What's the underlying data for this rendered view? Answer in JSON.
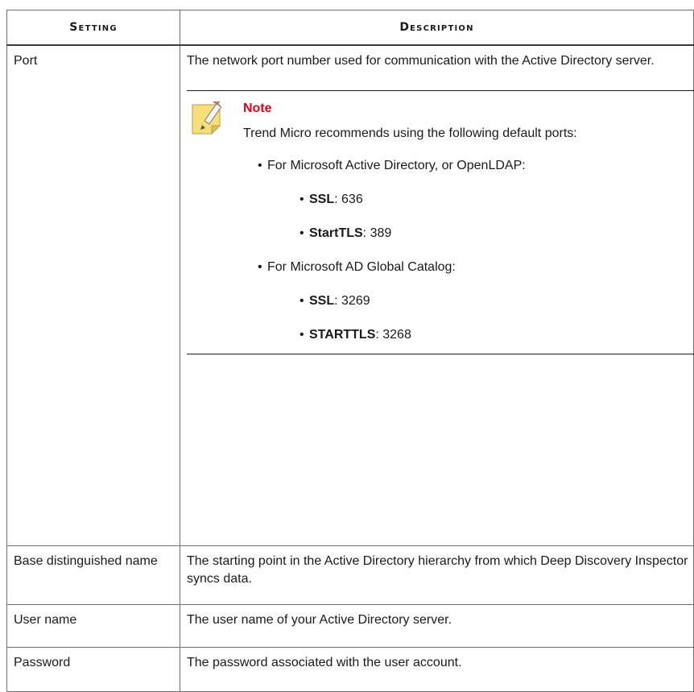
{
  "table": {
    "headers": [
      "Setting",
      "Description"
    ],
    "rows": [
      {
        "setting": "Port",
        "description": "The network port number used for communication with the Active Directory server."
      },
      {
        "setting": "Base distinguished name",
        "description": "The starting point in the Active Directory hierarchy from which Deep Discovery Inspector syncs data."
      },
      {
        "setting": "User name",
        "description": "The user name of your Active Directory server."
      },
      {
        "setting": "Password",
        "description": "The password associated with the user account."
      }
    ]
  },
  "note": {
    "title": "Note",
    "text": "Trend Micro recommends using the following default ports:",
    "groups": [
      {
        "label": "For Microsoft Active Directory, or OpenLDAP:",
        "items": [
          {
            "name": "SSL",
            "value": ": 636"
          },
          {
            "name": "StartTLS",
            "value": ": 389"
          }
        ]
      },
      {
        "label": "For Microsoft AD Global Catalog:",
        "items": [
          {
            "name": "SSL",
            "value": ": 3269"
          },
          {
            "name": "STARTTLS",
            "value": ": 3268"
          }
        ]
      }
    ],
    "icon": "note-pencil-icon",
    "title_color": "#e3001b"
  }
}
